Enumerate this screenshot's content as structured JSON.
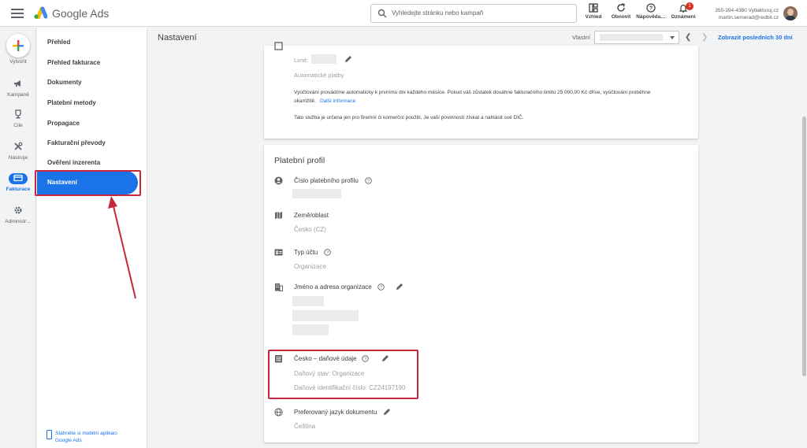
{
  "header": {
    "app_name": "Google Ads",
    "search_placeholder": "Vyhledejte stránku nebo kampaň",
    "tools": [
      {
        "label": "Vzhled",
        "icon": "layout-icon"
      },
      {
        "label": "Obnovit",
        "icon": "refresh-icon"
      },
      {
        "label": "Nápověda…",
        "icon": "help-icon"
      },
      {
        "label": "Oznámení",
        "icon": "bell-icon",
        "badge": "1"
      }
    ],
    "account_line1": "355-394-4380 Vytlakturuj.cz",
    "account_line2": "martin.semerad@redbit.cz"
  },
  "rail": {
    "create_label": "Vytvořit",
    "items": [
      {
        "label": "Kampaně",
        "icon": "megaphone-icon"
      },
      {
        "label": "Cíle",
        "icon": "trophy-icon"
      },
      {
        "label": "Nástroje",
        "icon": "tools-icon"
      },
      {
        "label": "Fakturace",
        "icon": "credit-card-icon",
        "active": true
      },
      {
        "label": "Administr…",
        "icon": "gear-icon"
      }
    ]
  },
  "subnav": {
    "items": [
      "Přehled",
      "Přehled fakturace",
      "Dokumenty",
      "Platební metody",
      "Propagace",
      "Fakturační převody",
      "Ověření inzerenta"
    ],
    "active": "Nastavení",
    "mobile_app_line1": "Stáhněte si mobilní aplikaci",
    "mobile_app_line2": "Google Ads"
  },
  "page": {
    "title": "Nastavení",
    "range_label": "Vlastní",
    "last_30": "Zobrazit posledních 30 dní"
  },
  "card_limit": {
    "limit_label": "Limit:",
    "auto_payments": "Automatické platby",
    "desc_line1": "Vyúčtování provádíme automaticky k prvnímu dni každého měsíce. Pokud váš zůstatek dosáhne fakturačního limitu 25 000,00 Kč dříve, vyúčtování proběhne",
    "desc_line2": "okamžitě.",
    "more_info": "Další informace",
    "company_note": "Tato služba je určena jen pro firemní či komerční použití. Je vaší povinností získat a nahlásit své DIČ."
  },
  "payment_profile": {
    "title": "Platební profil",
    "profile_number_label": "Číslo platebního profilu",
    "country_label": "Země/oblast",
    "country_value": "Česko (CZ)",
    "account_type_label": "Typ účtu",
    "account_type_value": "Organizace",
    "org_label": "Jméno a adresa organizace",
    "tax_label": "Česko – daňové údaje",
    "tax_status": "Daňový stav: Organizace",
    "tax_id": "Daňové identifikační číslo: CZ24197190",
    "language_label": "Preferovaný jazyk dokumentu",
    "language_value": "Čeština"
  },
  "colors": {
    "accent": "#1a73e8",
    "highlight": "#c5283d"
  }
}
